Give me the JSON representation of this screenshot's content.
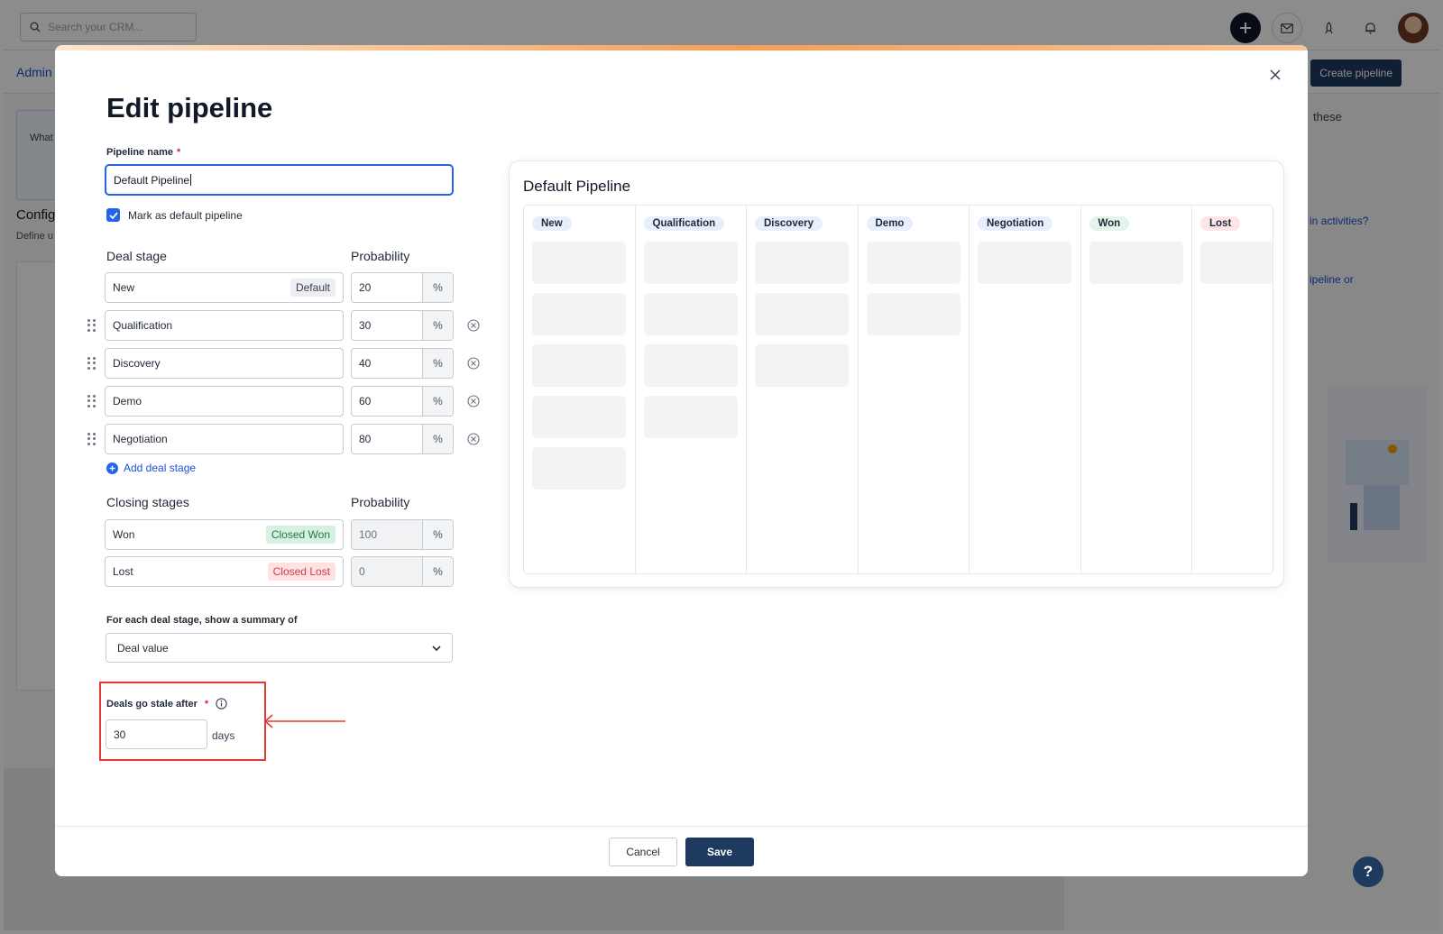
{
  "background": {
    "search_placeholder": "Search your CRM...",
    "admin_link": "Admin",
    "create_pipeline": "Create pipeline",
    "right_text_these": "these",
    "right_link_activities": "in activities?",
    "right_link_pipeline": "ipeline or",
    "left_fragment_what": "What",
    "left_fragment_config": "Config",
    "left_fragment_define": "Define u"
  },
  "modal": {
    "title": "Edit pipeline",
    "pipeline_name_label": "Pipeline name",
    "required_mark": "*",
    "pipeline_name_value": "Default Pipeline",
    "default_checkbox_label": "Mark as default pipeline",
    "deal_stage_header": "Deal stage",
    "probability_header": "Probability",
    "percent_unit": "%",
    "stages": [
      {
        "name": "New",
        "badge": "Default",
        "probability": "20"
      },
      {
        "name": "Qualification",
        "probability": "30"
      },
      {
        "name": "Discovery",
        "probability": "40"
      },
      {
        "name": "Demo",
        "probability": "60"
      },
      {
        "name": "Negotiation",
        "probability": "80"
      }
    ],
    "add_stage_label": "Add deal stage",
    "closing_stages_header": "Closing stages",
    "closing_probability_header": "Probability",
    "closing_stages": [
      {
        "name": "Won",
        "badge": "Closed Won",
        "probability": "100"
      },
      {
        "name": "Lost",
        "badge": "Closed Lost",
        "probability": "0"
      }
    ],
    "summary_label": "For each deal stage, show a summary of",
    "summary_value": "Deal value",
    "stale_label": "Deals go stale after",
    "stale_value": "30",
    "stale_unit": "days",
    "cancel_label": "Cancel",
    "save_label": "Save"
  },
  "preview": {
    "title": "Default Pipeline",
    "columns": [
      {
        "label": "New",
        "cards": 5
      },
      {
        "label": "Qualification",
        "cards": 4
      },
      {
        "label": "Discovery",
        "cards": 3
      },
      {
        "label": "Demo",
        "cards": 2
      },
      {
        "label": "Negotiation",
        "cards": 1
      },
      {
        "label": "Won",
        "cards": 1
      },
      {
        "label": "Lost",
        "cards": 1
      }
    ]
  },
  "help": {
    "label": "?"
  },
  "colors": {
    "accent": "#2563eb",
    "primary_button": "#1e3a5f",
    "annotation_red": "#e53935"
  }
}
